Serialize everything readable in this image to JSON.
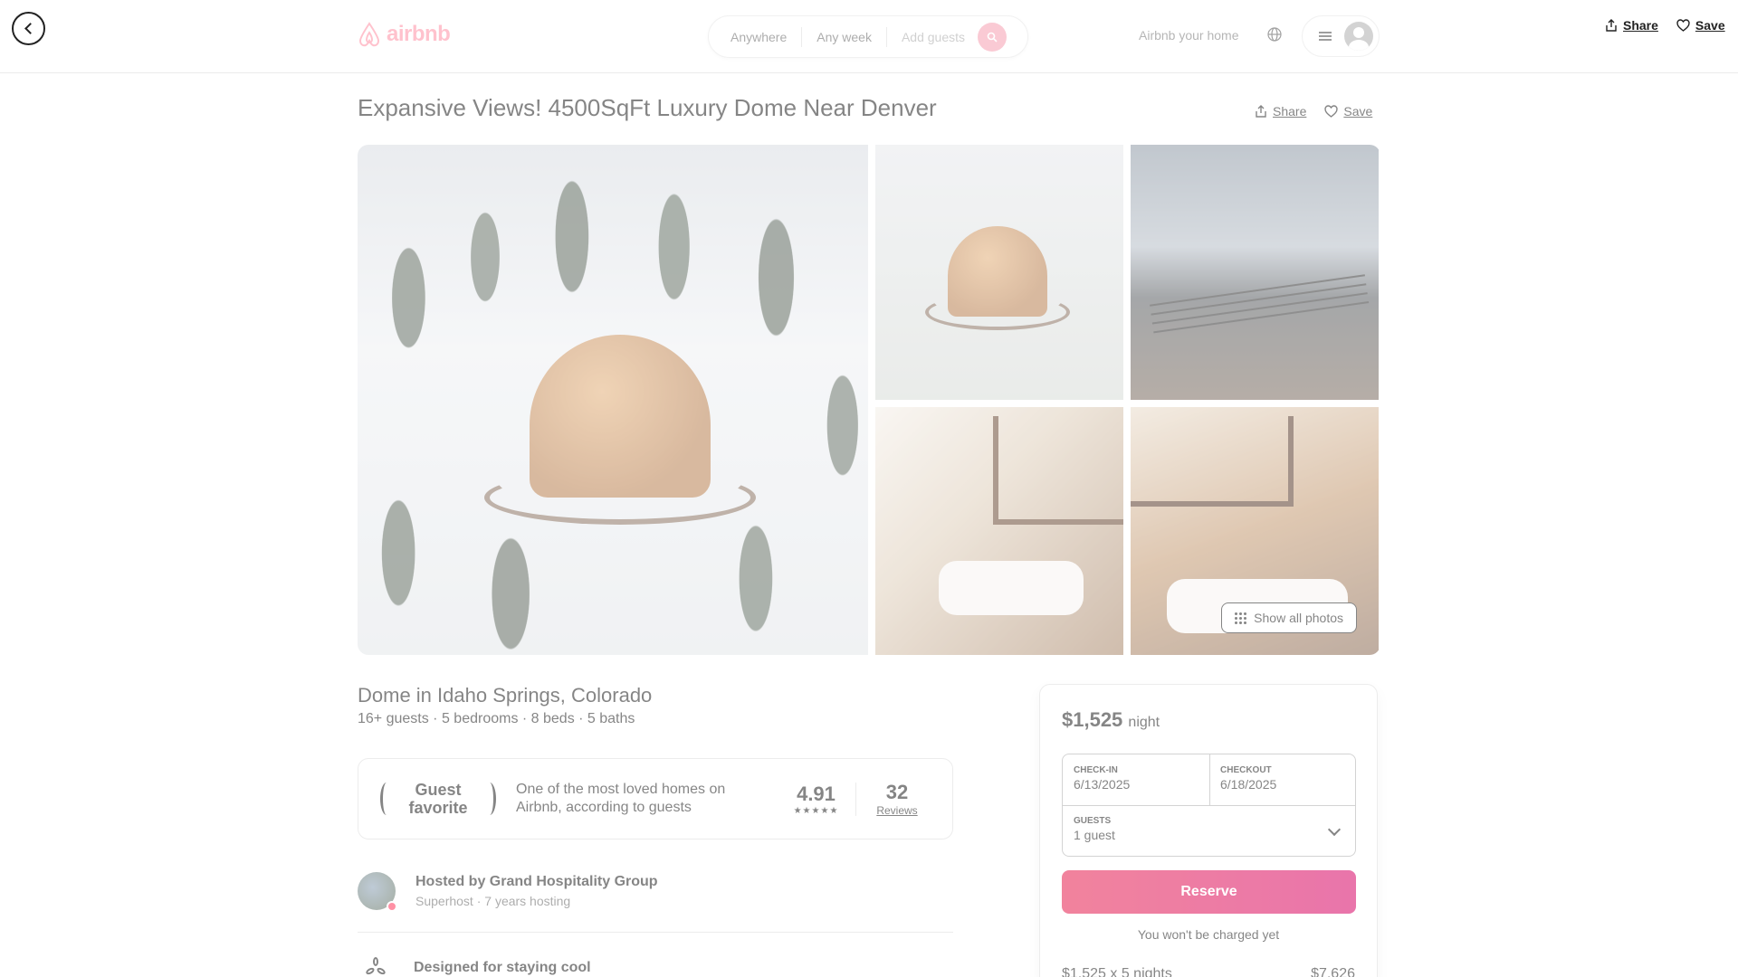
{
  "header": {
    "logo_text": "airbnb",
    "search": {
      "location": "Anywhere",
      "dates": "Any week",
      "guests": "Add guests"
    },
    "host_link": "Airbnb your home",
    "share_label": "Share",
    "save_label": "Save"
  },
  "listing": {
    "title": "Expansive Views! 4500SqFt Luxury Dome Near Denver",
    "share_label": "Share",
    "save_label": "Save",
    "show_all_photos": "Show all photos",
    "type_location": "Dome in Idaho Springs, Colorado",
    "details": "16+ guests · 5 bedrooms · 8 beds · 5 baths"
  },
  "guest_favorite": {
    "badge_line1": "Guest",
    "badge_line2": "favorite",
    "description": "One of the most loved homes on Airbnb, according to guests",
    "rating": "4.91",
    "stars": "★★★★★",
    "reviews_count": "32",
    "reviews_label": "Reviews"
  },
  "host": {
    "name": "Hosted by Grand Hospitality Group",
    "subtitle": "Superhost · 7 years hosting"
  },
  "highlights": [
    {
      "text": "Designed for staying cool",
      "icon": "fan-icon"
    }
  ],
  "booking": {
    "price": "$1,525",
    "price_unit": "night",
    "checkin_label": "CHECK-IN",
    "checkin_value": "6/13/2025",
    "checkout_label": "CHECKOUT",
    "checkout_value": "6/18/2025",
    "guests_label": "GUESTS",
    "guests_value": "1 guest",
    "reserve_label": "Reserve",
    "note": "You won't be charged yet",
    "calc_label": "$1,525 x 5 nights",
    "calc_total": "$7,626"
  },
  "colors": {
    "brand": "#ff385c",
    "reserve_start": "#e61e4d",
    "reserve_end": "#d70466"
  }
}
